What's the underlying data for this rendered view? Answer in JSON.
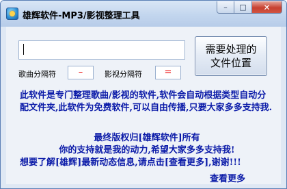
{
  "window": {
    "title": "雄辉软件-MP3/影视整理工具",
    "controls": {
      "minimize": "–",
      "maximize": "□",
      "close": "✕"
    }
  },
  "form": {
    "path_value": "",
    "song_sep_label": "歌曲分隔符",
    "song_sep_value": "–",
    "video_sep_label": "影视分隔符",
    "video_sep_value": "="
  },
  "action_button": {
    "label": "需要处理的\n文件位置"
  },
  "description": "此软件是专门整理歌曲/影视的软件,软件会自动根据类型自动分配文件夹,此软件为免费软件,可以自由传播,只要大家多多支持我.",
  "notice": {
    "line1": "最终版权归[雄辉软件]所有",
    "line2": "你的支持就是我的动力,希望大家多多支持我!",
    "line3": "想要了解[雄辉]最新动态信息,请点击[查看更多],谢谢!!!"
  },
  "more_link": "查看更多",
  "colors": {
    "accent_text": "#0a1aa8",
    "separator_text": "#e11111"
  }
}
